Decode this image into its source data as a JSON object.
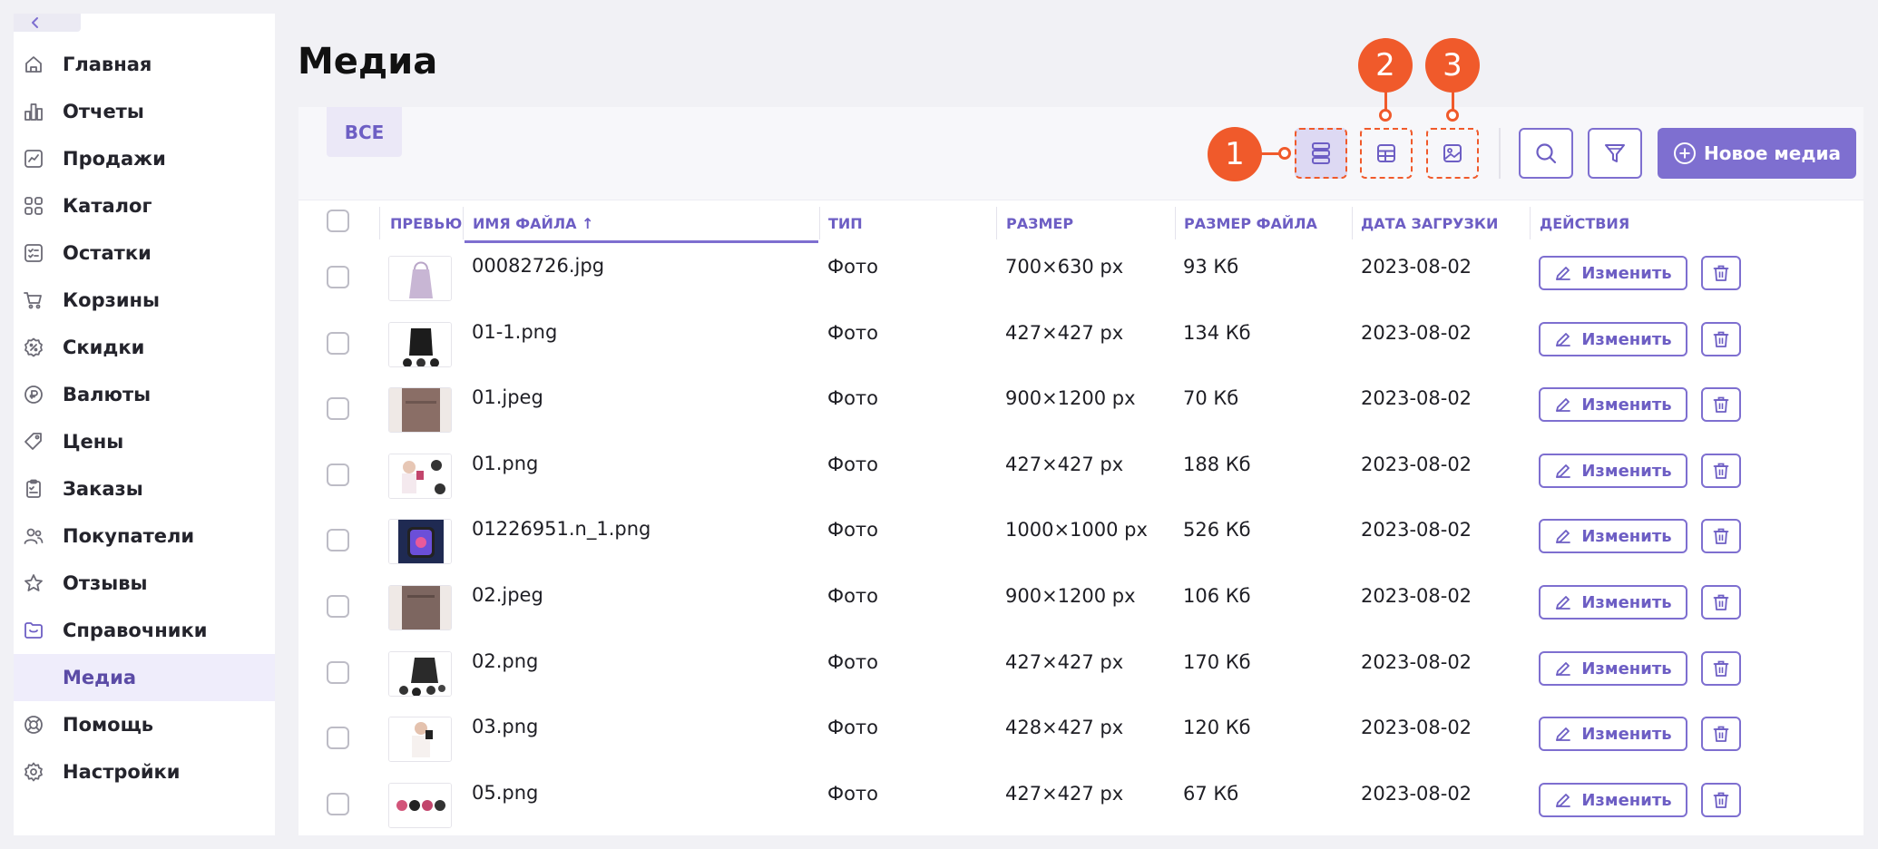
{
  "sidebar": {
    "collapse_icon": "chevron-left-icon",
    "items": [
      {
        "label": "Главная",
        "icon": "home-icon"
      },
      {
        "label": "Отчеты",
        "icon": "bar-chart-icon"
      },
      {
        "label": "Продажи",
        "icon": "trend-chart-icon"
      },
      {
        "label": "Каталог",
        "icon": "grid-icon"
      },
      {
        "label": "Остатки",
        "icon": "checklist-icon"
      },
      {
        "label": "Корзины",
        "icon": "cart-icon"
      },
      {
        "label": "Скидки",
        "icon": "percent-icon"
      },
      {
        "label": "Валюты",
        "icon": "currency-icon"
      },
      {
        "label": "Цены",
        "icon": "tag-icon"
      },
      {
        "label": "Заказы",
        "icon": "clipboard-icon"
      },
      {
        "label": "Покупатели",
        "icon": "users-icon"
      },
      {
        "label": "Отзывы",
        "icon": "star-icon"
      },
      {
        "label": "Справочники",
        "icon": "folder-icon"
      },
      {
        "label": "Медиа",
        "icon": "",
        "active": true
      },
      {
        "label": "Помощь",
        "icon": "lifebuoy-icon"
      },
      {
        "label": "Настройки",
        "icon": "gear-icon"
      }
    ]
  },
  "main": {
    "title": "Медиа",
    "tabs": [
      {
        "label": "ВСЕ",
        "active": true
      }
    ],
    "view_badges": [
      "1",
      "2",
      "3"
    ],
    "new_media_label": "Новое медиа"
  },
  "table": {
    "headers": {
      "preview": "ПРЕВЬЮ",
      "name": "ИМЯ ФАЙЛА ↑",
      "type": "ТИП",
      "size": "РАЗМЕР",
      "file_size": "РАЗМЕР ФАЙЛА",
      "date": "ДАТА ЗАГРУЗКИ",
      "actions": "ДЕЙСТВИЯ"
    },
    "edit_label": "Изменить",
    "rows": [
      {
        "name": "00082726.jpg",
        "type": "Фото",
        "size": "700×630 px",
        "file_size": "93 Кб",
        "date": "2023-08-02"
      },
      {
        "name": "01-1.png",
        "type": "Фото",
        "size": "427×427 px",
        "file_size": "134 Кб",
        "date": "2023-08-02"
      },
      {
        "name": "01.jpeg",
        "type": "Фото",
        "size": "900×1200 px",
        "file_size": "70 Кб",
        "date": "2023-08-02"
      },
      {
        "name": "01.png",
        "type": "Фото",
        "size": "427×427 px",
        "file_size": "188 Кб",
        "date": "2023-08-02"
      },
      {
        "name": "01226951.n_1.png",
        "type": "Фото",
        "size": "1000×1000 px",
        "file_size": "526 Кб",
        "date": "2023-08-02"
      },
      {
        "name": "02.jpeg",
        "type": "Фото",
        "size": "900×1200 px",
        "file_size": "106 Кб",
        "date": "2023-08-02"
      },
      {
        "name": "02.png",
        "type": "Фото",
        "size": "427×427 px",
        "file_size": "170 Кб",
        "date": "2023-08-02"
      },
      {
        "name": "03.png",
        "type": "Фото",
        "size": "428×427 px",
        "file_size": "120 Кб",
        "date": "2023-08-02"
      },
      {
        "name": "05.png",
        "type": "Фото",
        "size": "427×427 px",
        "file_size": "67 Кб",
        "date": "2023-08-02"
      }
    ]
  },
  "colors": {
    "accent": "#7e6fd0",
    "annotation": "#f05a2b"
  }
}
